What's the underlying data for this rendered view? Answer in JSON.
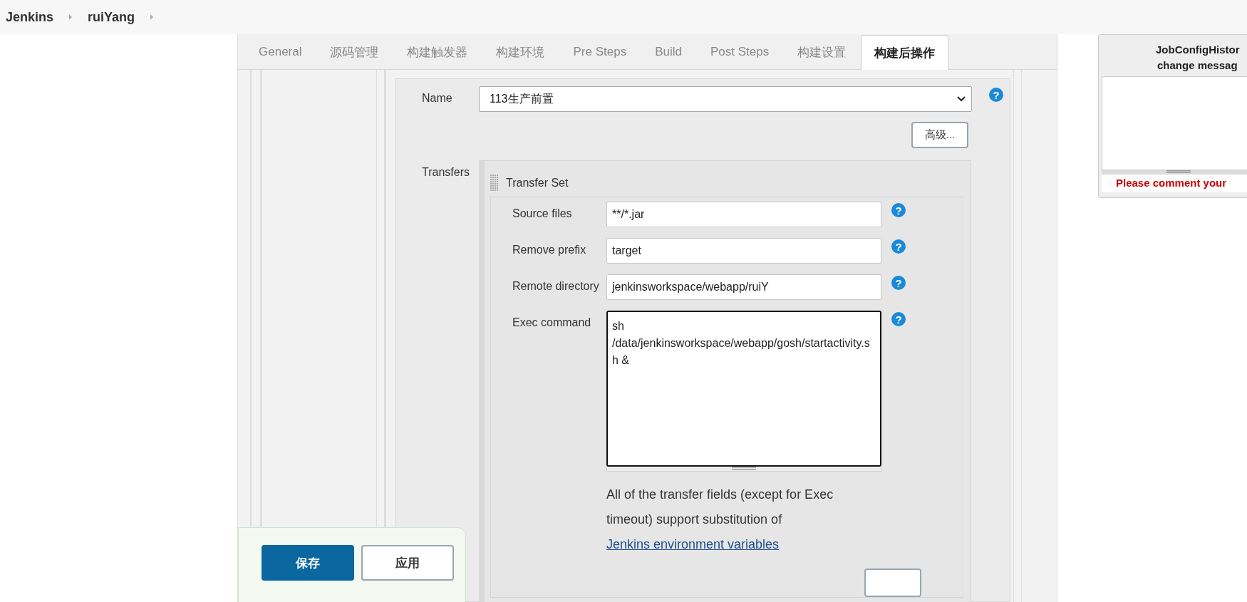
{
  "breadcrumbs": [
    {
      "label": "Jenkins"
    },
    {
      "label": "ruiYang"
    }
  ],
  "tabs": [
    {
      "label": "General",
      "selected": false
    },
    {
      "label": "源码管理",
      "selected": false
    },
    {
      "label": "构建触发器",
      "selected": false
    },
    {
      "label": "构建环境",
      "selected": false
    },
    {
      "label": "Pre Steps",
      "selected": false
    },
    {
      "label": "Build",
      "selected": false
    },
    {
      "label": "Post Steps",
      "selected": false
    },
    {
      "label": "构建设置",
      "selected": false
    },
    {
      "label": "构建后操作",
      "selected": true
    }
  ],
  "ssh_server": {
    "name_label": "Name",
    "name_value": "113生产前置",
    "name_help": "?",
    "advanced_button": "高级...",
    "transfers_label": "Transfers",
    "transfer_set": {
      "title": "Transfer Set",
      "fields": [
        {
          "label": "Source files",
          "value": "**/*.jar",
          "kind": "input",
          "help": "?"
        },
        {
          "label": "Remove prefix",
          "value": "target",
          "kind": "input",
          "help": "?"
        },
        {
          "label": "Remote directory",
          "value": "jenkinsworkspace/webapp/ruiY",
          "kind": "input",
          "help": "?"
        },
        {
          "label": "Exec command",
          "value": "sh /data/jenkinsworkspace/webapp/gosh/startactivity.sh &",
          "kind": "textarea",
          "help": "?"
        }
      ],
      "help_text": "All of the transfer fields (except for Exec timeout) support substitution of",
      "help_link": "Jenkins environment variables"
    }
  },
  "actions": [
    {
      "label": "保存",
      "kind": "primary"
    },
    {
      "label": "应用",
      "kind": "secondary"
    }
  ],
  "history_panel": {
    "title_lines": [
      "JobConfigHistor",
      "change messag"
    ],
    "warning": "Please comment your"
  }
}
